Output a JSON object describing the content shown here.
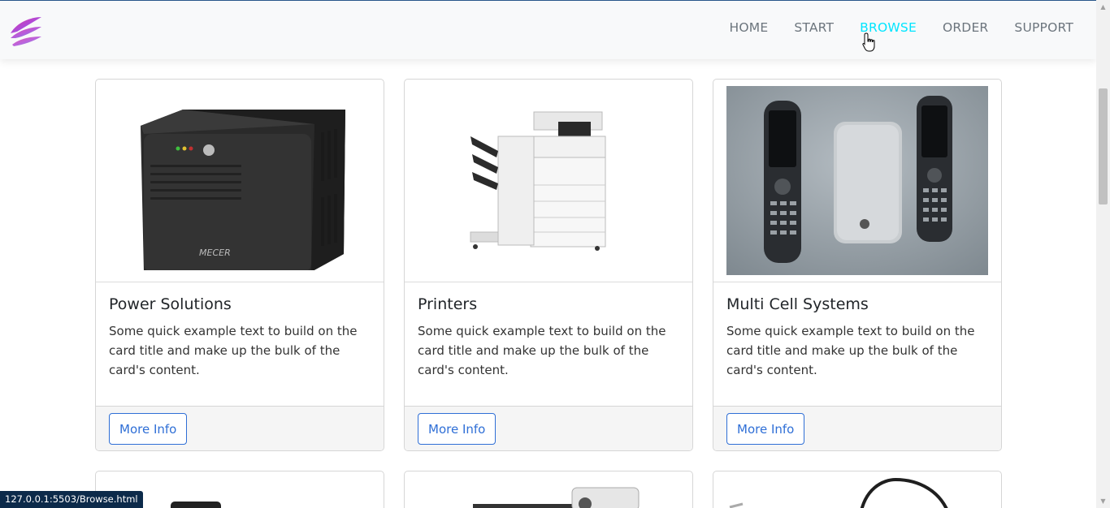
{
  "navbar": {
    "logo": "brand-logo",
    "items": [
      {
        "label": "HOME",
        "active": false
      },
      {
        "label": "START",
        "active": false
      },
      {
        "label": "BROWSE",
        "active": true
      },
      {
        "label": "ORDER",
        "active": false
      },
      {
        "label": "SUPPORT",
        "active": false
      }
    ],
    "active_color": "#00e5ff",
    "inactive_color": "#6c757d"
  },
  "cards": [
    {
      "title": "Power Solutions",
      "text": "Some quick example text to build on the card title and make up the bulk of the card's content.",
      "button": "More Info",
      "image": "ups-device-image",
      "brand_text": "MECER"
    },
    {
      "title": "Printers",
      "text": "Some quick example text to build on the card title and make up the bulk of the card's content.",
      "button": "More Info",
      "image": "printer-image"
    },
    {
      "title": "Multi Cell Systems",
      "text": "Some quick example text to build on the card title and make up the bulk of the card's content.",
      "button": "More Info",
      "image": "dect-phones-image"
    }
  ],
  "next_row_images": [
    "router-image",
    "security-camera-image",
    "headset-image"
  ],
  "status_bar": {
    "url": "127.0.0.1:5503/Browse.html"
  },
  "colors": {
    "button_outline": "#2f6fd6",
    "navbar_bg": "#f8f9fa"
  }
}
